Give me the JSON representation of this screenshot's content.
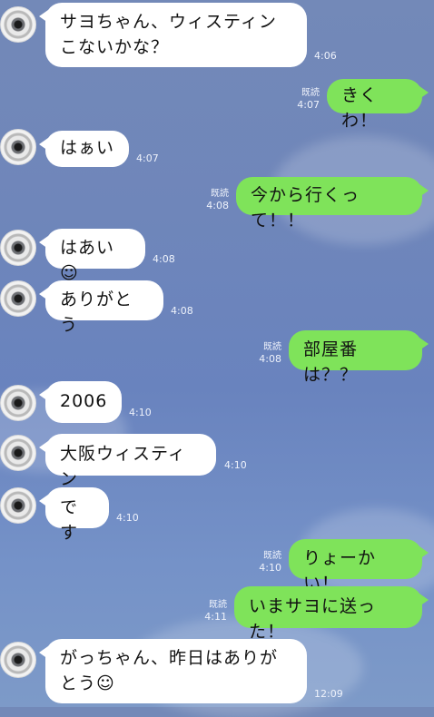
{
  "chat": {
    "read_label": "既読",
    "messages": [
      {
        "side": "in",
        "text": "サヨちゃん、ウィスティンこないかな？",
        "time": "4:06"
      },
      {
        "side": "out",
        "text": "きくわ！",
        "time": "4:07"
      },
      {
        "side": "in",
        "text": "はぁい",
        "time": "4:07"
      },
      {
        "side": "out",
        "text": "今から行くって！！",
        "time": "4:08"
      },
      {
        "side": "in",
        "text": "はあい☺",
        "time": "4:08"
      },
      {
        "side": "in",
        "text": "ありがとう",
        "time": "4:08"
      },
      {
        "side": "out",
        "text": "部屋番は？？",
        "time": "4:08"
      },
      {
        "side": "in",
        "text": "2006",
        "time": "4:10"
      },
      {
        "side": "in",
        "text": "大阪ウィスティン",
        "time": "4:10"
      },
      {
        "side": "in",
        "text": "です",
        "time": "4:10"
      },
      {
        "side": "out",
        "text": "りょーかい！",
        "time": "4:10"
      },
      {
        "side": "out",
        "text": "いまサヨに送った！",
        "time": "4:11"
      },
      {
        "side": "in",
        "text": "がっちゃん、昨日はありがとう☺",
        "time": "12:09"
      }
    ]
  }
}
